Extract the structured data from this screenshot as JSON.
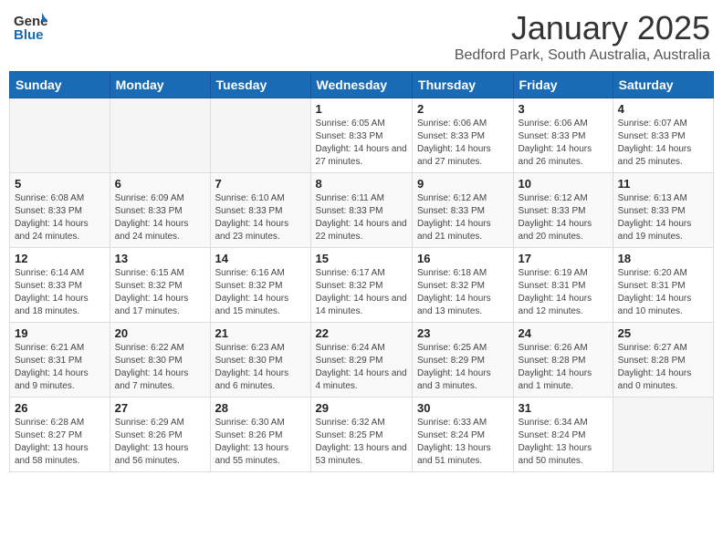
{
  "header": {
    "logo_general": "General",
    "logo_blue": "Blue",
    "month": "January 2025",
    "location": "Bedford Park, South Australia, Australia"
  },
  "weekdays": [
    "Sunday",
    "Monday",
    "Tuesday",
    "Wednesday",
    "Thursday",
    "Friday",
    "Saturday"
  ],
  "weeks": [
    [
      {
        "day": "",
        "info": ""
      },
      {
        "day": "",
        "info": ""
      },
      {
        "day": "",
        "info": ""
      },
      {
        "day": "1",
        "info": "Sunrise: 6:05 AM\nSunset: 8:33 PM\nDaylight: 14 hours and 27 minutes."
      },
      {
        "day": "2",
        "info": "Sunrise: 6:06 AM\nSunset: 8:33 PM\nDaylight: 14 hours and 27 minutes."
      },
      {
        "day": "3",
        "info": "Sunrise: 6:06 AM\nSunset: 8:33 PM\nDaylight: 14 hours and 26 minutes."
      },
      {
        "day": "4",
        "info": "Sunrise: 6:07 AM\nSunset: 8:33 PM\nDaylight: 14 hours and 25 minutes."
      }
    ],
    [
      {
        "day": "5",
        "info": "Sunrise: 6:08 AM\nSunset: 8:33 PM\nDaylight: 14 hours and 24 minutes."
      },
      {
        "day": "6",
        "info": "Sunrise: 6:09 AM\nSunset: 8:33 PM\nDaylight: 14 hours and 24 minutes."
      },
      {
        "day": "7",
        "info": "Sunrise: 6:10 AM\nSunset: 8:33 PM\nDaylight: 14 hours and 23 minutes."
      },
      {
        "day": "8",
        "info": "Sunrise: 6:11 AM\nSunset: 8:33 PM\nDaylight: 14 hours and 22 minutes."
      },
      {
        "day": "9",
        "info": "Sunrise: 6:12 AM\nSunset: 8:33 PM\nDaylight: 14 hours and 21 minutes."
      },
      {
        "day": "10",
        "info": "Sunrise: 6:12 AM\nSunset: 8:33 PM\nDaylight: 14 hours and 20 minutes."
      },
      {
        "day": "11",
        "info": "Sunrise: 6:13 AM\nSunset: 8:33 PM\nDaylight: 14 hours and 19 minutes."
      }
    ],
    [
      {
        "day": "12",
        "info": "Sunrise: 6:14 AM\nSunset: 8:33 PM\nDaylight: 14 hours and 18 minutes."
      },
      {
        "day": "13",
        "info": "Sunrise: 6:15 AM\nSunset: 8:32 PM\nDaylight: 14 hours and 17 minutes."
      },
      {
        "day": "14",
        "info": "Sunrise: 6:16 AM\nSunset: 8:32 PM\nDaylight: 14 hours and 15 minutes."
      },
      {
        "day": "15",
        "info": "Sunrise: 6:17 AM\nSunset: 8:32 PM\nDaylight: 14 hours and 14 minutes."
      },
      {
        "day": "16",
        "info": "Sunrise: 6:18 AM\nSunset: 8:32 PM\nDaylight: 14 hours and 13 minutes."
      },
      {
        "day": "17",
        "info": "Sunrise: 6:19 AM\nSunset: 8:31 PM\nDaylight: 14 hours and 12 minutes."
      },
      {
        "day": "18",
        "info": "Sunrise: 6:20 AM\nSunset: 8:31 PM\nDaylight: 14 hours and 10 minutes."
      }
    ],
    [
      {
        "day": "19",
        "info": "Sunrise: 6:21 AM\nSunset: 8:31 PM\nDaylight: 14 hours and 9 minutes."
      },
      {
        "day": "20",
        "info": "Sunrise: 6:22 AM\nSunset: 8:30 PM\nDaylight: 14 hours and 7 minutes."
      },
      {
        "day": "21",
        "info": "Sunrise: 6:23 AM\nSunset: 8:30 PM\nDaylight: 14 hours and 6 minutes."
      },
      {
        "day": "22",
        "info": "Sunrise: 6:24 AM\nSunset: 8:29 PM\nDaylight: 14 hours and 4 minutes."
      },
      {
        "day": "23",
        "info": "Sunrise: 6:25 AM\nSunset: 8:29 PM\nDaylight: 14 hours and 3 minutes."
      },
      {
        "day": "24",
        "info": "Sunrise: 6:26 AM\nSunset: 8:28 PM\nDaylight: 14 hours and 1 minute."
      },
      {
        "day": "25",
        "info": "Sunrise: 6:27 AM\nSunset: 8:28 PM\nDaylight: 14 hours and 0 minutes."
      }
    ],
    [
      {
        "day": "26",
        "info": "Sunrise: 6:28 AM\nSunset: 8:27 PM\nDaylight: 13 hours and 58 minutes."
      },
      {
        "day": "27",
        "info": "Sunrise: 6:29 AM\nSunset: 8:26 PM\nDaylight: 13 hours and 56 minutes."
      },
      {
        "day": "28",
        "info": "Sunrise: 6:30 AM\nSunset: 8:26 PM\nDaylight: 13 hours and 55 minutes."
      },
      {
        "day": "29",
        "info": "Sunrise: 6:32 AM\nSunset: 8:25 PM\nDaylight: 13 hours and 53 minutes."
      },
      {
        "day": "30",
        "info": "Sunrise: 6:33 AM\nSunset: 8:24 PM\nDaylight: 13 hours and 51 minutes."
      },
      {
        "day": "31",
        "info": "Sunrise: 6:34 AM\nSunset: 8:24 PM\nDaylight: 13 hours and 50 minutes."
      },
      {
        "day": "",
        "info": ""
      }
    ]
  ]
}
